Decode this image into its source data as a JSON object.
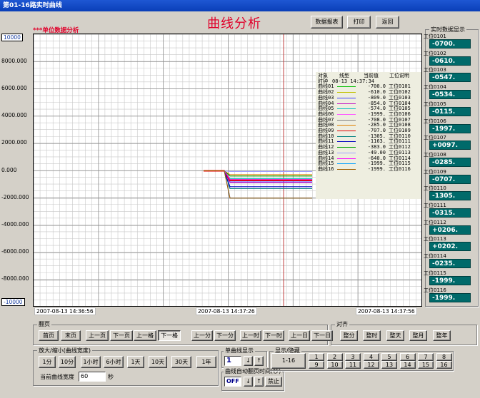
{
  "window": {
    "title": "第01-16路实时曲线"
  },
  "header": {
    "title": "曲线分析",
    "btn_report": "数据报表",
    "btn_print": "打印",
    "btn_back": "返回"
  },
  "plot": {
    "subtitle": "***单位数据分析",
    "y_ticks": [
      "10000",
      "8000.000",
      "6000.000",
      "4000.000",
      "2000.000",
      "0.000",
      "-2000.000",
      "-4000.000",
      "-6000.000",
      "-8000.000",
      "-10000"
    ],
    "x_labels": [
      "2007-08-13 14:36:56",
      "2007-08-13 14:37:26",
      "2007-08-13 14:37:56"
    ]
  },
  "legend": {
    "headers": [
      "对象",
      "线型",
      "当前值",
      "工位说明"
    ],
    "time_label": "时钟",
    "time_value": "08-13 14:37:34",
    "rows": [
      {
        "name": "曲线01",
        "color": "#00c000",
        "value": "-700.0",
        "desc": "工位0101"
      },
      {
        "name": "曲线02",
        "color": "#c0c000",
        "value": "-610.0",
        "desc": "工位0102"
      },
      {
        "name": "曲线03",
        "color": "#4040ff",
        "value": "-809.0",
        "desc": "工位0103"
      },
      {
        "name": "曲线04",
        "color": "#c000c0",
        "value": "-854.0",
        "desc": "工位0104"
      },
      {
        "name": "曲线05",
        "color": "#00c0c0",
        "value": "-574.0",
        "desc": "工位0105"
      },
      {
        "name": "曲线06",
        "color": "#ff60ff",
        "value": "-1999.",
        "desc": "工位0106"
      },
      {
        "name": "曲线07",
        "color": "#808080",
        "value": "-708.0",
        "desc": "工位0107"
      },
      {
        "name": "曲线08",
        "color": "#e08000",
        "value": "-285.0",
        "desc": "工位0108"
      },
      {
        "name": "曲线09",
        "color": "#e00000",
        "value": "-707.0",
        "desc": "工位0109"
      },
      {
        "name": "曲线10",
        "color": "#008080",
        "value": "-1305.",
        "desc": "工位0110"
      },
      {
        "name": "曲线11",
        "color": "#0000c0",
        "value": "-1163.",
        "desc": "工位0111"
      },
      {
        "name": "曲线12",
        "color": "#00a000",
        "value": "-383.0",
        "desc": "工位0112"
      },
      {
        "name": "曲线13",
        "color": "#a0a0ff",
        "value": "-49.00",
        "desc": "工位0113"
      },
      {
        "name": "曲线14",
        "color": "#ff00ff",
        "value": "-640.0",
        "desc": "工位0114"
      },
      {
        "name": "曲线15",
        "color": "#00a0ff",
        "value": "-1999.",
        "desc": "工位0115"
      },
      {
        "name": "曲线16",
        "color": "#a06000",
        "value": "-1999.",
        "desc": "工位0116"
      }
    ]
  },
  "realtime": {
    "title": "实时数据显示",
    "items": [
      {
        "label": "工位0101",
        "value": "-0700."
      },
      {
        "label": "工位0102",
        "value": "-0610."
      },
      {
        "label": "工位0103",
        "value": "-0547."
      },
      {
        "label": "工位0104",
        "value": "-0534."
      },
      {
        "label": "工位0105",
        "value": "-0115."
      },
      {
        "label": "工位0106",
        "value": "-1997."
      },
      {
        "label": "工位0107",
        "value": "+0097."
      },
      {
        "label": "工位0108",
        "value": "-0285."
      },
      {
        "label": "工位0109",
        "value": "-0707."
      },
      {
        "label": "工位0110",
        "value": "-1305."
      },
      {
        "label": "工位0111",
        "value": "-0315."
      },
      {
        "label": "工位0112",
        "value": "+0206."
      },
      {
        "label": "工位0113",
        "value": "+0202."
      },
      {
        "label": "工位0114",
        "value": "-0235."
      },
      {
        "label": "工位0115",
        "value": "-1999."
      },
      {
        "label": "工位0116",
        "value": "-1999."
      }
    ]
  },
  "controls": {
    "page_group": "翻页",
    "page_buttons": [
      "首页",
      "末页",
      "上一页",
      "下一页",
      "上一格",
      "下一格",
      "上一分",
      "下一分",
      "上一时",
      "下一时",
      "上一日",
      "下一日"
    ],
    "align_group": "对齐",
    "align_buttons": [
      "整分",
      "整时",
      "整天",
      "整月",
      "整年"
    ],
    "zoom_group": "放大/缩小(曲线宽度)",
    "zoom_buttons": [
      "1分",
      "10分",
      "1小时",
      "6小时",
      "1天",
      "10天",
      "30天",
      "1年"
    ],
    "width_label": "当前曲线宽度",
    "width_value": "60",
    "width_unit": "秒",
    "single_group": "单曲线显示",
    "single_value": "1",
    "showhide_group": "显示/隐藏",
    "showhide_all": "1-16",
    "showhide_top": [
      "1",
      "3",
      "5",
      "6",
      "8"
    ],
    "showhide_top_a": [
      "2"
    ],
    "showhide_top_b": [
      "4"
    ],
    "showhide_top_c": [
      "7"
    ],
    "showhide_bottom": [
      "9",
      "10",
      "11",
      "12",
      "13",
      "14",
      "15",
      "16"
    ],
    "auto_group": "曲线自动翻页时间(秒)",
    "auto_value": "OFF",
    "auto_stop": "禁止"
  },
  "chart_data": {
    "type": "line",
    "ylim": [
      -10000,
      10000
    ],
    "xlabels": [
      "2007-08-13 14:36:56",
      "2007-08-13 14:37:26",
      "2007-08-13 14:37:56"
    ],
    "series": [
      {
        "name": "曲线01",
        "value": -700
      },
      {
        "name": "曲线02",
        "value": -610
      },
      {
        "name": "曲线03",
        "value": -809
      },
      {
        "name": "曲线04",
        "value": -854
      },
      {
        "name": "曲线05",
        "value": -574
      },
      {
        "name": "曲线06",
        "value": -1999
      },
      {
        "name": "曲线07",
        "value": -708
      },
      {
        "name": "曲线08",
        "value": -285
      },
      {
        "name": "曲线09",
        "value": -707
      },
      {
        "name": "曲线10",
        "value": -1305
      },
      {
        "name": "曲线11",
        "value": -1163
      },
      {
        "name": "曲线12",
        "value": -383
      },
      {
        "name": "曲线13",
        "value": -49
      },
      {
        "name": "曲线14",
        "value": -640
      },
      {
        "name": "曲线15",
        "value": -1999
      },
      {
        "name": "曲线16",
        "value": -1999
      }
    ]
  }
}
